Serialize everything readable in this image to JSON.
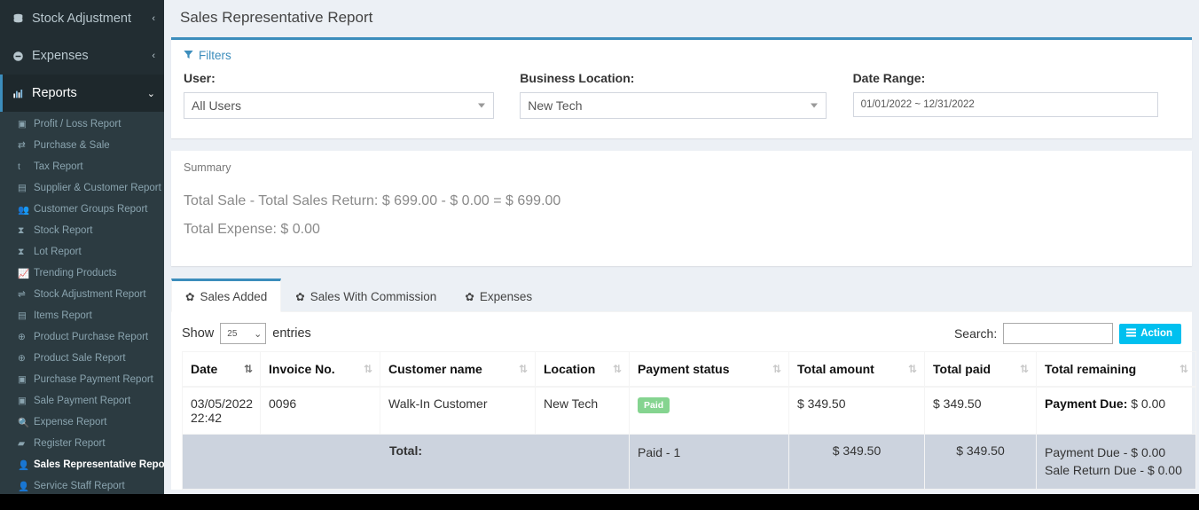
{
  "sidebar": {
    "main_items": [
      {
        "label": "Stock Adjustment",
        "icon": "database-icon",
        "arrow": "‹",
        "active": false
      },
      {
        "label": "Expenses",
        "icon": "minus-circle-icon",
        "arrow": "‹",
        "active": false
      },
      {
        "label": "Reports",
        "icon": "bar-chart-icon",
        "arrow": "⌄",
        "active": true
      }
    ],
    "sub_items": [
      {
        "label": "Profit / Loss Report",
        "icon": "money-icon"
      },
      {
        "label": "Purchase & Sale",
        "icon": "exchange-icon"
      },
      {
        "label": "Tax Report",
        "icon": "tax-icon"
      },
      {
        "label": "Supplier & Customer Report",
        "icon": "contact-icon"
      },
      {
        "label": "Customer Groups Report",
        "icon": "users-icon"
      },
      {
        "label": "Stock Report",
        "icon": "hourglass-icon"
      },
      {
        "label": "Lot Report",
        "icon": "hourglass-icon"
      },
      {
        "label": "Trending Products",
        "icon": "line-chart-icon"
      },
      {
        "label": "Stock Adjustment Report",
        "icon": "sliders-icon"
      },
      {
        "label": "Items Report",
        "icon": "list-icon"
      },
      {
        "label": "Product Purchase Report",
        "icon": "arrow-circle-down-icon"
      },
      {
        "label": "Product Sale Report",
        "icon": "arrow-circle-up-icon"
      },
      {
        "label": "Purchase Payment Report",
        "icon": "money-icon"
      },
      {
        "label": "Sale Payment Report",
        "icon": "money-icon"
      },
      {
        "label": "Expense Report",
        "icon": "search-icon"
      },
      {
        "label": "Register Report",
        "icon": "briefcase-icon"
      },
      {
        "label": "Sales Representative Report",
        "icon": "user-icon",
        "active": true
      },
      {
        "label": "Service Staff Report",
        "icon": "user-icon"
      }
    ]
  },
  "header": {
    "title": "Sales Representative Report"
  },
  "filters": {
    "toggle_label": "Filters",
    "funnel_icon": "filter-icon",
    "user": {
      "label": "User:",
      "value": "All Users"
    },
    "business_location": {
      "label": "Business Location:",
      "value": "New Tech"
    },
    "date_range": {
      "label": "Date Range:",
      "value": "01/01/2022 ~ 12/31/2022"
    }
  },
  "summary": {
    "title": "Summary",
    "line1": "Total Sale - Total Sales Return: $ 699.00 - $ 0.00 = $ 699.00",
    "line2": "Total Expense: $ 0.00"
  },
  "tabs": [
    {
      "label": "Sales Added",
      "icon": "gear-icon",
      "active": true
    },
    {
      "label": "Sales With Commission",
      "icon": "gear-icon",
      "active": false
    },
    {
      "label": "Expenses",
      "icon": "gear-icon",
      "active": false
    }
  ],
  "table_controls": {
    "show_label": "Show",
    "entries_value": "25",
    "entries_label": "entries",
    "search_label": "Search:",
    "search_value": "",
    "search_placeholder": "",
    "action_label": "Action",
    "action_icon": "list-icon"
  },
  "table": {
    "columns": [
      {
        "label": "Date",
        "sort": "desc"
      },
      {
        "label": "Invoice No.",
        "sort": "none"
      },
      {
        "label": "Customer name",
        "sort": "none"
      },
      {
        "label": "Location",
        "sort": "none"
      },
      {
        "label": "Payment status",
        "sort": "none"
      },
      {
        "label": "Total amount",
        "sort": "none"
      },
      {
        "label": "Total paid",
        "sort": "none"
      },
      {
        "label": "Total remaining",
        "sort": "none"
      }
    ],
    "rows": [
      {
        "date": "03/05/2022 22:42",
        "invoice_no": "0096",
        "customer_name": "Walk-In Customer",
        "location": "New Tech",
        "payment_status": "Paid",
        "total_amount": "$ 349.50",
        "total_paid": "$ 349.50",
        "remaining_label": "Payment Due:",
        "remaining_value": "$ 0.00"
      }
    ],
    "footer": {
      "total_label": "Total:",
      "payment_status": "Paid - 1",
      "total_amount": "$ 349.50",
      "total_paid": "$ 349.50",
      "remaining_line1": "Payment Due - $ 0.00",
      "remaining_line2": "Sale Return Due - $ 0.00"
    }
  },
  "colors": {
    "sidebar_bg": "#222d32",
    "submenu_bg": "#2c3b41",
    "accent_blue": "#3c8dbc",
    "page_bg": "#ecf0f5",
    "action_btn": "#00c0ef",
    "paid_badge": "#85d490",
    "footer_bg": "#ccd3de"
  }
}
